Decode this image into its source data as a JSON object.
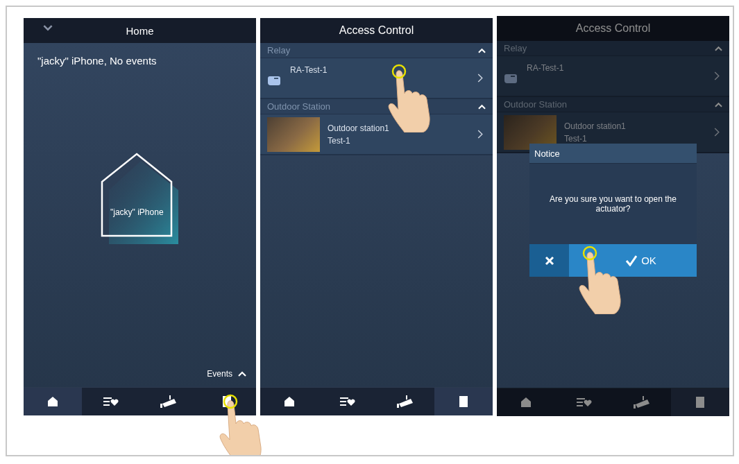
{
  "screens": [
    {
      "kind": "home",
      "title": "Home",
      "status": "\"jacky\" iPhone, No events",
      "house_label": "\"jacky\" iPhone",
      "events_label": "Events",
      "tabs": [
        {
          "kind": "home",
          "selected": true
        },
        {
          "kind": "favorites",
          "selected": false
        },
        {
          "kind": "camera",
          "selected": false
        },
        {
          "kind": "door",
          "selected": false
        }
      ]
    },
    {
      "kind": "access",
      "title": "Access Control",
      "dimmed": false,
      "sections": [
        {
          "title": "Relay",
          "expanded": true,
          "items": [
            {
              "kind": "relay",
              "name": "RA-Test-1"
            }
          ]
        },
        {
          "title": "Outdoor Station",
          "expanded": true,
          "items": [
            {
              "kind": "station",
              "name": "Outdoor station1",
              "subtitle": "Test-1"
            }
          ]
        }
      ],
      "tabs": [
        {
          "kind": "home",
          "selected": false
        },
        {
          "kind": "favorites",
          "selected": false
        },
        {
          "kind": "camera",
          "selected": false
        },
        {
          "kind": "door",
          "selected": true
        }
      ]
    },
    {
      "kind": "access",
      "title": "Access Control",
      "dimmed": true,
      "sections": [
        {
          "title": "Relay",
          "expanded": true,
          "items": [
            {
              "kind": "relay",
              "name": "RA-Test-1"
            }
          ]
        },
        {
          "title": "Outdoor Station",
          "expanded": true,
          "items": [
            {
              "kind": "station",
              "name": "Outdoor station1",
              "subtitle": "Test-1"
            }
          ]
        }
      ],
      "tabs": [
        {
          "kind": "home",
          "selected": false
        },
        {
          "kind": "favorites",
          "selected": false
        },
        {
          "kind": "camera",
          "selected": false
        },
        {
          "kind": "door",
          "selected": true
        }
      ],
      "dialog": {
        "title": "Notice",
        "message": "Are you sure you want to open the actuator?",
        "ok": "OK"
      }
    }
  ]
}
